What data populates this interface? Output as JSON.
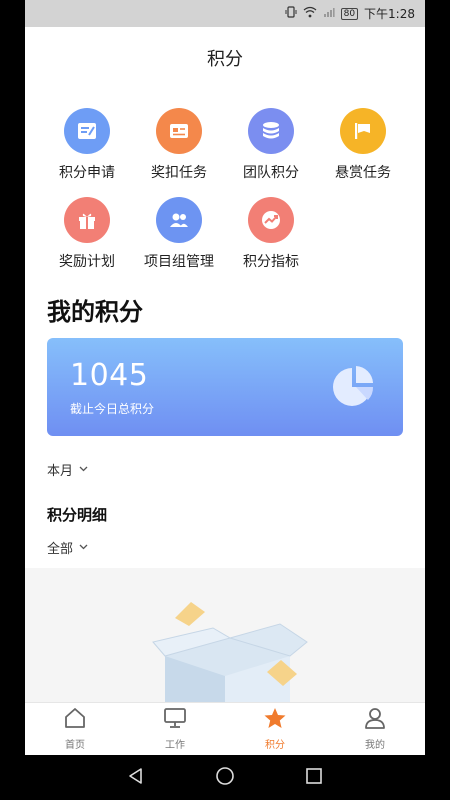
{
  "status_bar": {
    "time": "下午1:28",
    "battery": "80"
  },
  "header": {
    "title": "积分"
  },
  "menu": [
    {
      "label": "积分申请",
      "icon": "form-icon",
      "color": "#6e9df5"
    },
    {
      "label": "奖扣任务",
      "icon": "id-card-icon",
      "color": "#f4884b"
    },
    {
      "label": "团队积分",
      "icon": "coins-stack-icon",
      "color": "#7b8ef0"
    },
    {
      "label": "悬赏任务",
      "icon": "flag-icon",
      "color": "#f6b427"
    },
    {
      "label": "奖励计划",
      "icon": "gift-icon",
      "color": "#f27f75"
    },
    {
      "label": "项目组管理",
      "icon": "team-icon",
      "color": "#6d94f2"
    },
    {
      "label": "积分指标",
      "icon": "trend-icon",
      "color": "#f27f75"
    }
  ],
  "my_points": {
    "section_title": "我的积分",
    "total": "1045",
    "caption": "截止今日总积分"
  },
  "filters": {
    "period": "本月",
    "detail_title": "积分明细",
    "category": "全部"
  },
  "tabs": [
    {
      "label": "首页",
      "icon": "home-icon",
      "active": false
    },
    {
      "label": "工作",
      "icon": "monitor-icon",
      "active": false
    },
    {
      "label": "积分",
      "icon": "star-icon",
      "active": true
    },
    {
      "label": "我的",
      "icon": "user-icon",
      "active": false
    }
  ],
  "colors": {
    "accent": "#f07b2d",
    "card_top": "#86bffb",
    "card_bottom": "#6f8ff2"
  }
}
